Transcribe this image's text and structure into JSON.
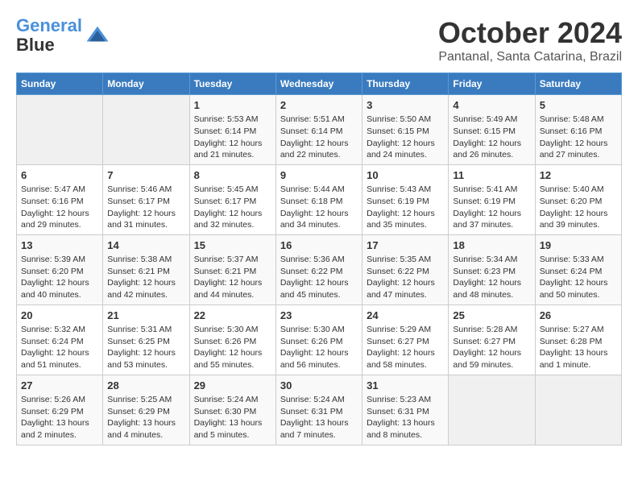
{
  "header": {
    "logo_line1": "General",
    "logo_line2": "Blue",
    "month": "October 2024",
    "location": "Pantanal, Santa Catarina, Brazil"
  },
  "weekdays": [
    "Sunday",
    "Monday",
    "Tuesday",
    "Wednesday",
    "Thursday",
    "Friday",
    "Saturday"
  ],
  "weeks": [
    [
      {
        "day": "",
        "empty": true
      },
      {
        "day": "",
        "empty": true
      },
      {
        "day": "1",
        "rise": "5:53 AM",
        "set": "6:14 PM",
        "hours": "12 hours and 21 minutes."
      },
      {
        "day": "2",
        "rise": "5:51 AM",
        "set": "6:14 PM",
        "hours": "12 hours and 22 minutes."
      },
      {
        "day": "3",
        "rise": "5:50 AM",
        "set": "6:15 PM",
        "hours": "12 hours and 24 minutes."
      },
      {
        "day": "4",
        "rise": "5:49 AM",
        "set": "6:15 PM",
        "hours": "12 hours and 26 minutes."
      },
      {
        "day": "5",
        "rise": "5:48 AM",
        "set": "6:16 PM",
        "hours": "12 hours and 27 minutes."
      }
    ],
    [
      {
        "day": "6",
        "rise": "5:47 AM",
        "set": "6:16 PM",
        "hours": "12 hours and 29 minutes."
      },
      {
        "day": "7",
        "rise": "5:46 AM",
        "set": "6:17 PM",
        "hours": "12 hours and 31 minutes."
      },
      {
        "day": "8",
        "rise": "5:45 AM",
        "set": "6:17 PM",
        "hours": "12 hours and 32 minutes."
      },
      {
        "day": "9",
        "rise": "5:44 AM",
        "set": "6:18 PM",
        "hours": "12 hours and 34 minutes."
      },
      {
        "day": "10",
        "rise": "5:43 AM",
        "set": "6:19 PM",
        "hours": "12 hours and 35 minutes."
      },
      {
        "day": "11",
        "rise": "5:41 AM",
        "set": "6:19 PM",
        "hours": "12 hours and 37 minutes."
      },
      {
        "day": "12",
        "rise": "5:40 AM",
        "set": "6:20 PM",
        "hours": "12 hours and 39 minutes."
      }
    ],
    [
      {
        "day": "13",
        "rise": "5:39 AM",
        "set": "6:20 PM",
        "hours": "12 hours and 40 minutes."
      },
      {
        "day": "14",
        "rise": "5:38 AM",
        "set": "6:21 PM",
        "hours": "12 hours and 42 minutes."
      },
      {
        "day": "15",
        "rise": "5:37 AM",
        "set": "6:21 PM",
        "hours": "12 hours and 44 minutes."
      },
      {
        "day": "16",
        "rise": "5:36 AM",
        "set": "6:22 PM",
        "hours": "12 hours and 45 minutes."
      },
      {
        "day": "17",
        "rise": "5:35 AM",
        "set": "6:22 PM",
        "hours": "12 hours and 47 minutes."
      },
      {
        "day": "18",
        "rise": "5:34 AM",
        "set": "6:23 PM",
        "hours": "12 hours and 48 minutes."
      },
      {
        "day": "19",
        "rise": "5:33 AM",
        "set": "6:24 PM",
        "hours": "12 hours and 50 minutes."
      }
    ],
    [
      {
        "day": "20",
        "rise": "5:32 AM",
        "set": "6:24 PM",
        "hours": "12 hours and 51 minutes."
      },
      {
        "day": "21",
        "rise": "5:31 AM",
        "set": "6:25 PM",
        "hours": "12 hours and 53 minutes."
      },
      {
        "day": "22",
        "rise": "5:30 AM",
        "set": "6:26 PM",
        "hours": "12 hours and 55 minutes."
      },
      {
        "day": "23",
        "rise": "5:30 AM",
        "set": "6:26 PM",
        "hours": "12 hours and 56 minutes."
      },
      {
        "day": "24",
        "rise": "5:29 AM",
        "set": "6:27 PM",
        "hours": "12 hours and 58 minutes."
      },
      {
        "day": "25",
        "rise": "5:28 AM",
        "set": "6:27 PM",
        "hours": "12 hours and 59 minutes."
      },
      {
        "day": "26",
        "rise": "5:27 AM",
        "set": "6:28 PM",
        "hours": "13 hours and 1 minute."
      }
    ],
    [
      {
        "day": "27",
        "rise": "5:26 AM",
        "set": "6:29 PM",
        "hours": "13 hours and 2 minutes."
      },
      {
        "day": "28",
        "rise": "5:25 AM",
        "set": "6:29 PM",
        "hours": "13 hours and 4 minutes."
      },
      {
        "day": "29",
        "rise": "5:24 AM",
        "set": "6:30 PM",
        "hours": "13 hours and 5 minutes."
      },
      {
        "day": "30",
        "rise": "5:24 AM",
        "set": "6:31 PM",
        "hours": "13 hours and 7 minutes."
      },
      {
        "day": "31",
        "rise": "5:23 AM",
        "set": "6:31 PM",
        "hours": "13 hours and 8 minutes."
      },
      {
        "day": "",
        "empty": true
      },
      {
        "day": "",
        "empty": true
      }
    ]
  ]
}
